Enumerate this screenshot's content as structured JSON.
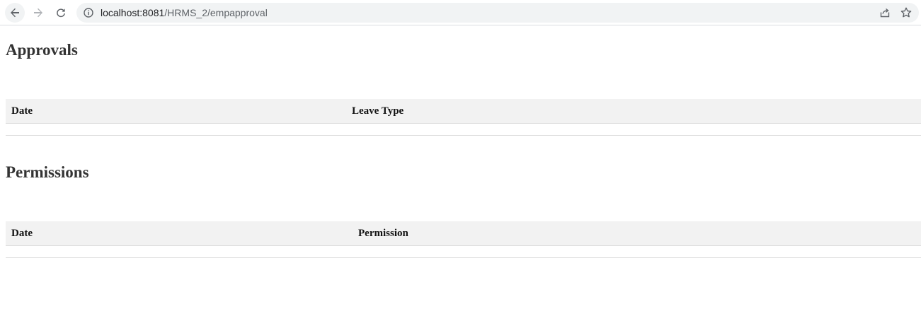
{
  "browser": {
    "url_host": "localhost:8081",
    "url_path": "/HRMS_2/empapproval",
    "icons": {
      "back": "arrow-left-icon",
      "forward": "arrow-right-icon",
      "reload": "reload-icon",
      "site_info": "info-icon",
      "share": "share-icon",
      "bookmark": "star-icon"
    }
  },
  "approvals": {
    "title": "Approvals",
    "columns": [
      "Date",
      "Leave Type"
    ],
    "rows": []
  },
  "permissions": {
    "title": "Permissions",
    "columns": [
      "Date",
      "Permission"
    ],
    "rows": []
  },
  "colors": {
    "header_bg": "#f2f2f2",
    "border": "#dddddd",
    "heading_text": "#333333"
  }
}
